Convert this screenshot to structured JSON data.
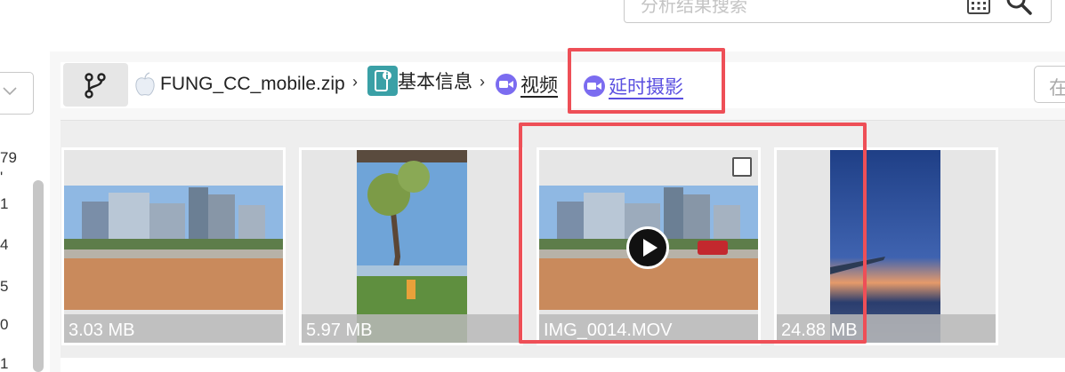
{
  "search": {
    "placeholder": "分析结果搜索"
  },
  "sidebar": {
    "counts": [
      "79",
      "'",
      "1",
      "4",
      "5",
      "0",
      "1"
    ]
  },
  "breadcrumb": {
    "items": [
      {
        "label": "FUNG_CC_mobile.zip",
        "icon": "apple-icon"
      },
      {
        "label": "基本信息",
        "icon": "device-info-icon"
      },
      {
        "label": "视频",
        "icon": "video-camera-icon"
      },
      {
        "label": "延时摄影",
        "icon": "video-camera-icon",
        "active": true
      }
    ],
    "separator": "›",
    "right_button_label": "在"
  },
  "gallery": {
    "items": [
      {
        "caption": "3.03 MB",
        "kind": "photo"
      },
      {
        "caption": "5.97 MB",
        "kind": "photo"
      },
      {
        "caption": "IMG_0014.MOV",
        "kind": "video"
      },
      {
        "caption": "24.88 MB",
        "kind": "photo"
      }
    ]
  },
  "colors": {
    "accent": "#7b6cf0",
    "active_link": "#5a4fe0",
    "annotation": "#ee4f57",
    "teal": "#3aa0a6"
  }
}
